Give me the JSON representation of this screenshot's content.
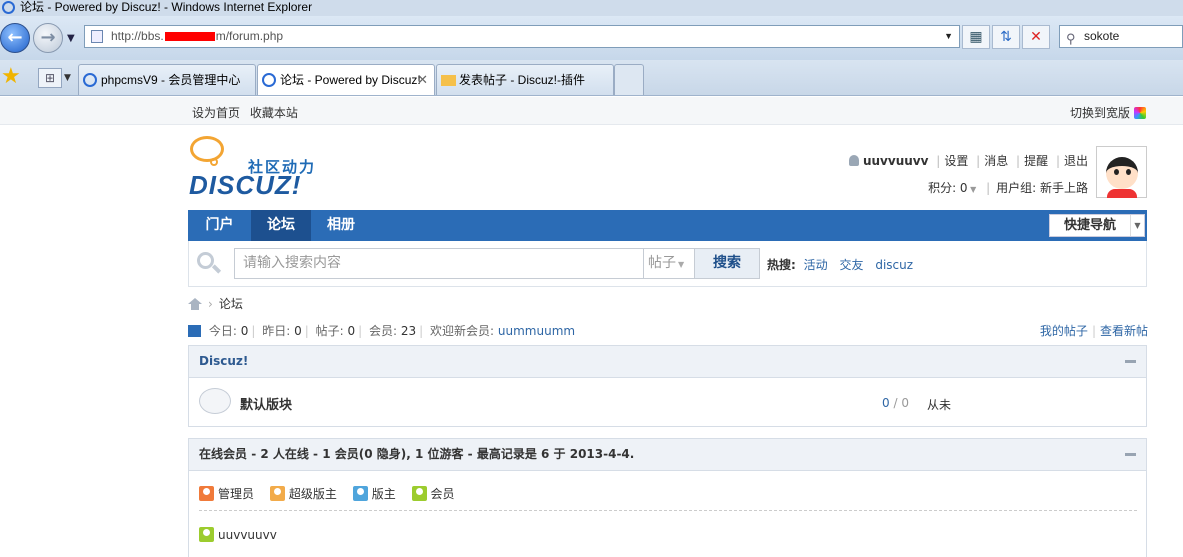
{
  "window": {
    "title": "论坛 - Powered by Discuz! - Windows Internet Explorer"
  },
  "address": {
    "url_prefix": "http://bbs.",
    "url_suffix": "m/forum.php",
    "search_value": "sokote"
  },
  "tabs": [
    {
      "label": "phpcmsV9 - 会员管理中心"
    },
    {
      "label": "论坛 - Powered by Discuz!"
    },
    {
      "label": "发表帖子 - Discuz!-插件Hac..."
    }
  ],
  "site": {
    "top_links": [
      "设为首页",
      "收藏本站"
    ],
    "wide_toggle": "切换到宽版",
    "logo_sub": "社区动力",
    "logo_main": "DISCUZ!"
  },
  "user": {
    "name": "uuvvuuvv",
    "links": [
      "设置",
      "消息",
      "提醒",
      "退出"
    ],
    "credits_label": "积分: 0",
    "group_label": "用户组: 新手上路"
  },
  "nav": {
    "items": [
      "门户",
      "论坛",
      "相册"
    ],
    "active": "论坛",
    "quicknav": "快捷导航"
  },
  "search": {
    "placeholder": "请输入搜索内容",
    "type": "帖子",
    "button": "搜索",
    "hot_label": "热搜:",
    "hot_terms": [
      "活动",
      "交友",
      "discuz"
    ]
  },
  "breadcrumb": {
    "current": "论坛"
  },
  "stats": {
    "today_label": "今日:",
    "today": "0",
    "yesterday_label": "昨日:",
    "yesterday": "0",
    "posts_label": "帖子:",
    "posts": "0",
    "members_label": "会员:",
    "members": "23",
    "welcome_label": "欢迎新会员:",
    "newest_member": "uummuumm",
    "my_posts": "我的帖子",
    "new_posts": "查看新帖"
  },
  "category": {
    "title": "Discuz!",
    "forum_name": "默认版块",
    "threads": "0",
    "posts": "0",
    "last_post": "从未"
  },
  "online": {
    "title": "在线会员",
    "summary": " - 2 人在线 - 1 会员(0 隐身), 1 位游客 - 最高记录是 6 于 2013-4-4.",
    "legend": [
      "管理员",
      "超级版主",
      "版主",
      "会员"
    ],
    "users": [
      "uuvvuuvv"
    ]
  }
}
